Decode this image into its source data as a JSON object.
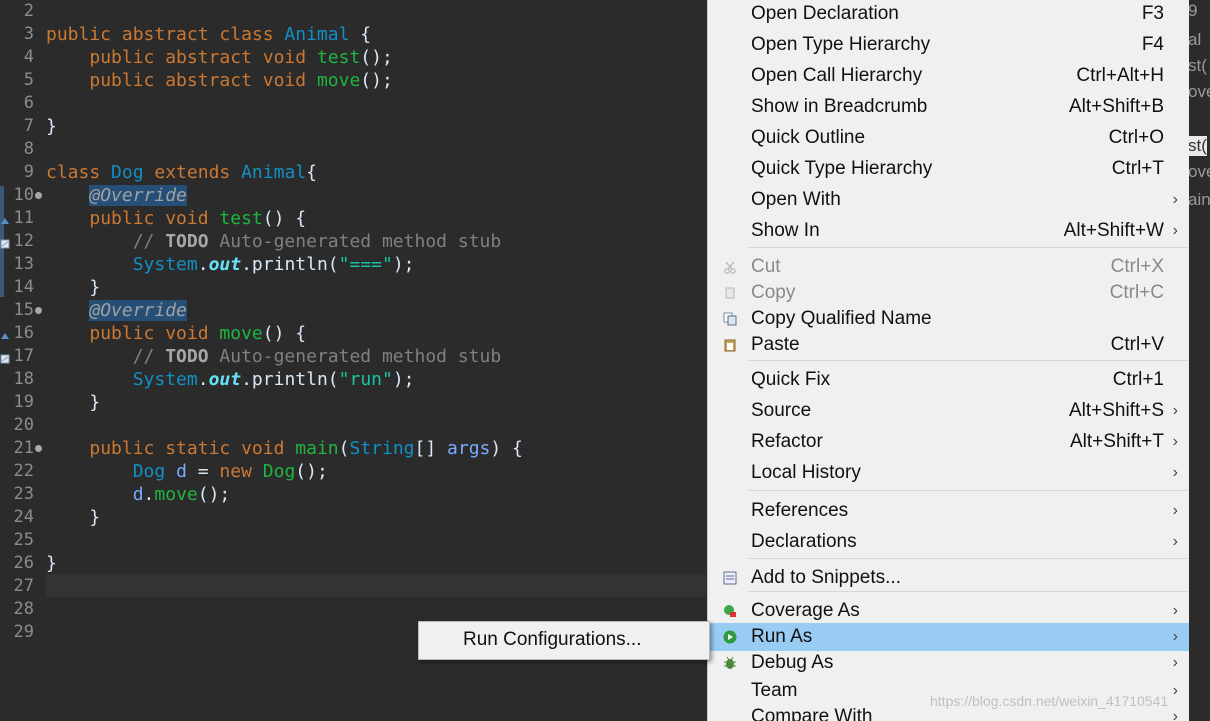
{
  "editor": {
    "line_numbers": [
      "2",
      "3",
      "4",
      "5",
      "6",
      "7",
      "8",
      "9",
      "10",
      "11",
      "12",
      "13",
      "14",
      "15",
      "16",
      "17",
      "18",
      "19",
      "20",
      "21",
      "22",
      "23",
      "24",
      "25",
      "26",
      "27",
      "28",
      "29"
    ],
    "lines": [
      [],
      [
        [
          "kw",
          "public abstract class "
        ],
        [
          "cls",
          "Animal"
        ],
        [
          "pln",
          " {"
        ]
      ],
      [
        [
          "pln",
          "    "
        ],
        [
          "kw",
          "public abstract void "
        ],
        [
          "mth",
          "test"
        ],
        [
          "pln",
          "();"
        ]
      ],
      [
        [
          "pln",
          "    "
        ],
        [
          "kw",
          "public abstract void "
        ],
        [
          "mth",
          "move"
        ],
        [
          "pln",
          "();"
        ]
      ],
      [],
      [
        [
          "pln",
          "}"
        ]
      ],
      [],
      [
        [
          "kw",
          "class "
        ],
        [
          "cls",
          "Dog"
        ],
        [
          "kw",
          " extends "
        ],
        [
          "cls",
          "Animal"
        ],
        [
          "pln",
          "{"
        ]
      ],
      [
        [
          "pln",
          "    "
        ],
        [
          "ann",
          "@Override"
        ]
      ],
      [
        [
          "pln",
          "    "
        ],
        [
          "kw",
          "public void "
        ],
        [
          "mth",
          "test"
        ],
        [
          "pln",
          "() {"
        ]
      ],
      [
        [
          "pln",
          "        "
        ],
        [
          "cmt",
          "// "
        ],
        [
          "todo",
          "TODO"
        ],
        [
          "cmt",
          " Auto-generated method stub"
        ]
      ],
      [
        [
          "pln",
          "        "
        ],
        [
          "cls",
          "System"
        ],
        [
          "pln",
          "."
        ],
        [
          "fld",
          "out"
        ],
        [
          "pln",
          ".println("
        ],
        [
          "str",
          "\"===\""
        ],
        [
          "pln",
          ");"
        ]
      ],
      [
        [
          "pln",
          "    }"
        ]
      ],
      [
        [
          "pln",
          "    "
        ],
        [
          "ann",
          "@Override"
        ]
      ],
      [
        [
          "pln",
          "    "
        ],
        [
          "kw",
          "public void "
        ],
        [
          "mth",
          "move"
        ],
        [
          "pln",
          "() {"
        ]
      ],
      [
        [
          "pln",
          "        "
        ],
        [
          "cmt",
          "// "
        ],
        [
          "todo",
          "TODO"
        ],
        [
          "cmt",
          " Auto-generated method stub"
        ]
      ],
      [
        [
          "pln",
          "        "
        ],
        [
          "cls",
          "System"
        ],
        [
          "pln",
          "."
        ],
        [
          "fld",
          "out"
        ],
        [
          "pln",
          ".println("
        ],
        [
          "str",
          "\"run\""
        ],
        [
          "pln",
          ");"
        ]
      ],
      [
        [
          "pln",
          "    }"
        ]
      ],
      [],
      [
        [
          "pln",
          "    "
        ],
        [
          "kw",
          "public static void "
        ],
        [
          "mth",
          "main"
        ],
        [
          "pln",
          "("
        ],
        [
          "cls",
          "String"
        ],
        [
          "pln",
          "[] "
        ],
        [
          "var",
          "args"
        ],
        [
          "pln",
          ") {"
        ]
      ],
      [
        [
          "pln",
          "        "
        ],
        [
          "cls",
          "Dog"
        ],
        [
          "pln",
          " "
        ],
        [
          "var",
          "d"
        ],
        [
          "pln",
          " = "
        ],
        [
          "kw",
          "new "
        ],
        [
          "mth",
          "Dog"
        ],
        [
          "pln",
          "();"
        ]
      ],
      [
        [
          "pln",
          "        "
        ],
        [
          "var",
          "d"
        ],
        [
          "pln",
          "."
        ],
        [
          "mth",
          "move"
        ],
        [
          "pln",
          "();"
        ]
      ],
      [
        [
          "pln",
          "    }"
        ]
      ],
      [],
      [
        [
          "pln",
          "}"
        ]
      ],
      [],
      [],
      []
    ],
    "peek_fragments": [
      "9",
      "al",
      "st(",
      "ove",
      "st(",
      "ove",
      "ain"
    ]
  },
  "menu": {
    "items": [
      {
        "label": "Open Declaration",
        "shortcut": "F3"
      },
      {
        "label": "Open Type Hierarchy",
        "shortcut": "F4"
      },
      {
        "label": "Open Call Hierarchy",
        "shortcut": "Ctrl+Alt+H"
      },
      {
        "label": "Show in Breadcrumb",
        "shortcut": "Alt+Shift+B"
      },
      {
        "label": "Quick Outline",
        "shortcut": "Ctrl+O"
      },
      {
        "label": "Quick Type Hierarchy",
        "shortcut": "Ctrl+T"
      },
      {
        "label": "Open With",
        "shortcut": "",
        "arrow": "›"
      },
      {
        "label": "Show In",
        "shortcut": "Alt+Shift+W",
        "arrow": "›"
      },
      {
        "label": "Cut",
        "shortcut": "Ctrl+X",
        "icon": "scissors-icon",
        "disabled": true
      },
      {
        "label": "Copy",
        "shortcut": "Ctrl+C",
        "icon": "copy-icon",
        "disabled": true
      },
      {
        "label": "Copy Qualified Name",
        "shortcut": "",
        "icon": "copy-qualified-icon"
      },
      {
        "label": "Paste",
        "shortcut": "Ctrl+V",
        "icon": "paste-icon"
      },
      {
        "label": "Quick Fix",
        "shortcut": "Ctrl+1"
      },
      {
        "label": "Source",
        "shortcut": "Alt+Shift+S",
        "arrow": "›"
      },
      {
        "label": "Refactor",
        "shortcut": "Alt+Shift+T",
        "arrow": "›"
      },
      {
        "label": "Local History",
        "shortcut": "",
        "arrow": "›"
      },
      {
        "label": "References",
        "shortcut": "",
        "arrow": "›"
      },
      {
        "label": "Declarations",
        "shortcut": "",
        "arrow": "›"
      },
      {
        "label": "Add to Snippets...",
        "shortcut": "",
        "icon": "snippets-icon"
      },
      {
        "label": "Coverage As",
        "shortcut": "",
        "icon": "coverage-icon",
        "arrow": "›"
      },
      {
        "label": "Run As",
        "shortcut": "",
        "icon": "run-icon",
        "arrow": "›",
        "highlighted": true
      },
      {
        "label": "Debug As",
        "shortcut": "",
        "icon": "debug-icon",
        "arrow": "›"
      },
      {
        "label": "Team",
        "shortcut": "",
        "arrow": "›"
      },
      {
        "label": "Compare With",
        "shortcut": "",
        "arrow": "›"
      }
    ]
  },
  "submenu": {
    "items": [
      {
        "label": "Run Configurations..."
      }
    ]
  },
  "watermark": "https://blog.csdn.net/weixin_41710541",
  "colors": {
    "highlight": "#99ccf3",
    "menu_bg": "#f0f0f0",
    "editor_bg": "#2b2b2b"
  }
}
